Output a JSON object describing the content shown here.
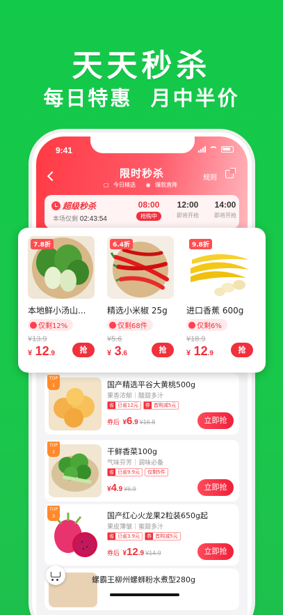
{
  "hero": {
    "title": "天天秒杀",
    "subtitle": "每日特惠  月中半价"
  },
  "status_bar": {
    "time": "9:41"
  },
  "nav": {
    "title": "限时秒杀",
    "tag1": "今日精选",
    "tag2": "爆款直降",
    "rule": "规则"
  },
  "session_bar": {
    "logo": "超级秒杀",
    "countdown_label": "本场仅剩",
    "countdown": "02:43:54",
    "sessions": [
      {
        "time": "08:00",
        "status": "抢购中",
        "active": true
      },
      {
        "time": "12:00",
        "status": "即将开抢",
        "active": false
      },
      {
        "time": "14:00",
        "status": "即将开抢",
        "active": false
      }
    ]
  },
  "deals": [
    {
      "discount": "7.8折",
      "name": "本地鲜小汤山...",
      "stock": "仅剩12%",
      "orig": "¥13.9",
      "cur": "¥",
      "int": "12",
      "dec": ".9",
      "buy": "抢",
      "icon": "bok-choy-image"
    },
    {
      "discount": "6.4折",
      "name": "精选小米椒 25g",
      "stock": "仅剩68件",
      "orig": "¥5.6",
      "cur": "¥",
      "int": "3",
      "dec": ".6",
      "buy": "抢",
      "icon": "chili-image"
    },
    {
      "discount": "9.8折",
      "name": "进口香蕉 600g",
      "stock": "仅剩6%",
      "orig": "¥18.9",
      "cur": "¥",
      "int": "12",
      "dec": ".9",
      "buy": "抢",
      "icon": "banana-image"
    }
  ],
  "rank_list": [
    {
      "badge": "TOP",
      "badge_num": "1",
      "title": "国产精选平谷大黄桃500g",
      "desc": "果香浓郁｜酸甜多汁",
      "coupons": [
        {
          "k": "省",
          "v": "已省12元"
        },
        {
          "k": "券",
          "v": "首购减5元"
        }
      ],
      "pre": "券后",
      "cur": "¥",
      "int": "6",
      "dec": ".9",
      "orig": "¥16.8",
      "buy": "立即抢"
    },
    {
      "badge": "TOP",
      "badge_num": "2",
      "title": "干鲜香菜100g",
      "desc": "气味芬芳｜调味必备",
      "coupons": [
        {
          "k": "省",
          "v": "已省9.9元"
        },
        {
          "k": "",
          "v": "仅剩5件"
        }
      ],
      "pre": "",
      "cur": "¥",
      "int": "4",
      "dec": ".9",
      "orig": "¥6.9",
      "buy": "立即抢"
    },
    {
      "badge": "TOP",
      "badge_num": "3",
      "title": "国产红心火龙果2粒装650g起",
      "desc": "果皮薄皱｜蜜甜多汁",
      "coupons": [
        {
          "k": "省",
          "v": "已省3.9元"
        },
        {
          "k": "券",
          "v": "首购减5元"
        }
      ],
      "pre": "券后",
      "cur": "¥",
      "int": "12",
      "dec": ".9",
      "orig": "¥14.9",
      "buy": "立即抢"
    }
  ],
  "peek_title": "螺霸王柳州螺蛳粉水煮型280g"
}
